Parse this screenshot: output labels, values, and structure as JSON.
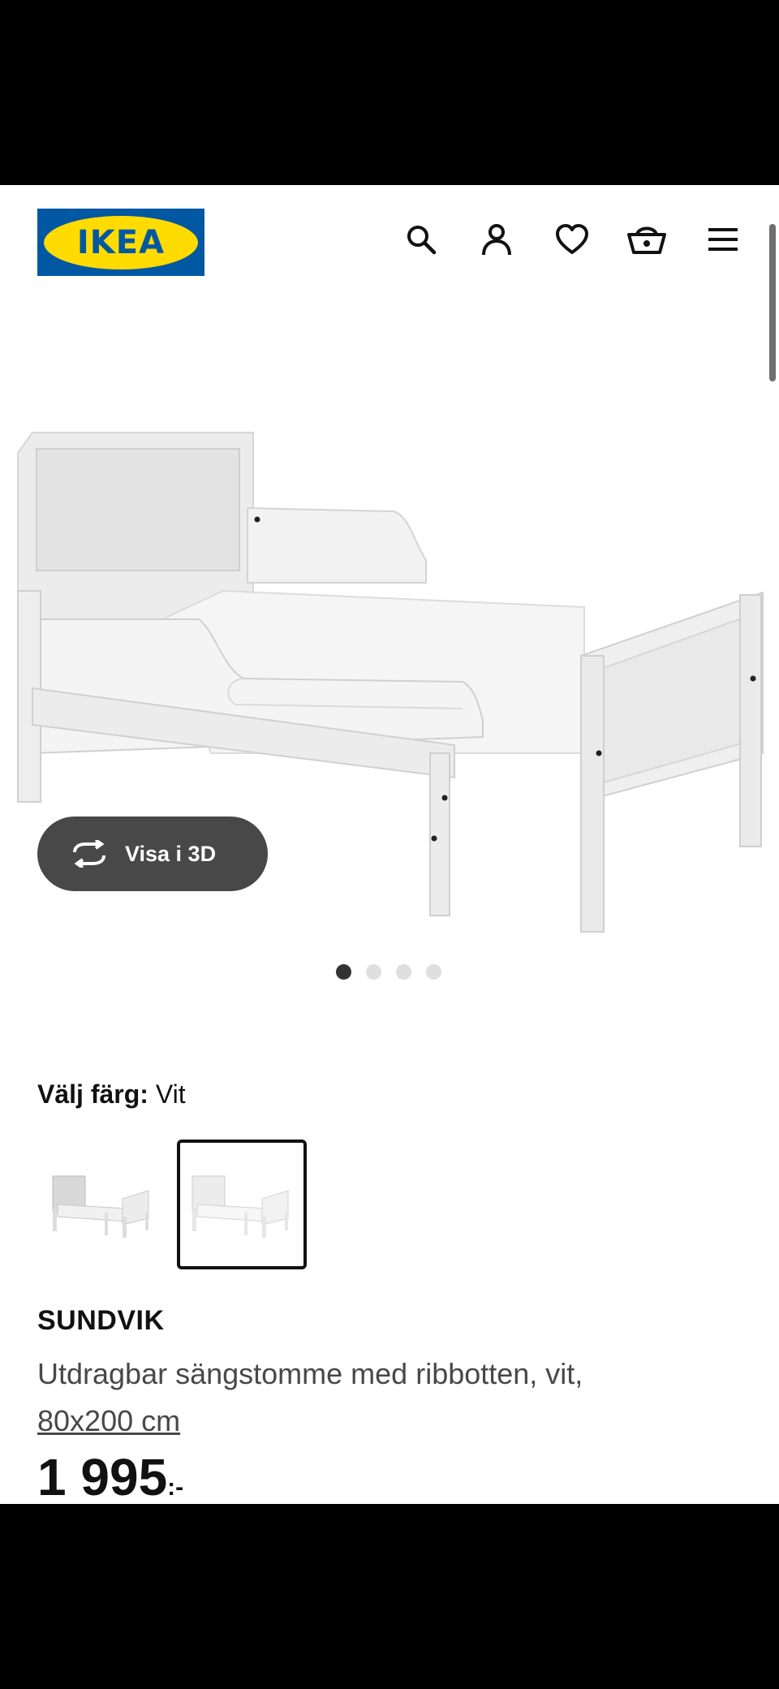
{
  "header": {
    "logo_text": "IKEA",
    "icons": [
      "search-icon",
      "user-icon",
      "heart-icon",
      "basket-icon",
      "menu-icon"
    ],
    "brand_blue": "#0058a3",
    "brand_yellow": "#ffdb00"
  },
  "hero": {
    "view_3d_label": "Visa i 3D",
    "carousel": {
      "count": 4,
      "active": 1
    }
  },
  "color": {
    "label": "Välj färg:",
    "value": "Vit",
    "swatches": [
      {
        "name": "grey-variant",
        "selected": false
      },
      {
        "name": "white-variant",
        "selected": true
      }
    ]
  },
  "product": {
    "name": "SUNDVIK",
    "description": "Utdragbar sängstomme med ribbotten, vit,",
    "size_link": "80x200 cm",
    "price_integer": "1 995",
    "price_suffix": ":-"
  }
}
